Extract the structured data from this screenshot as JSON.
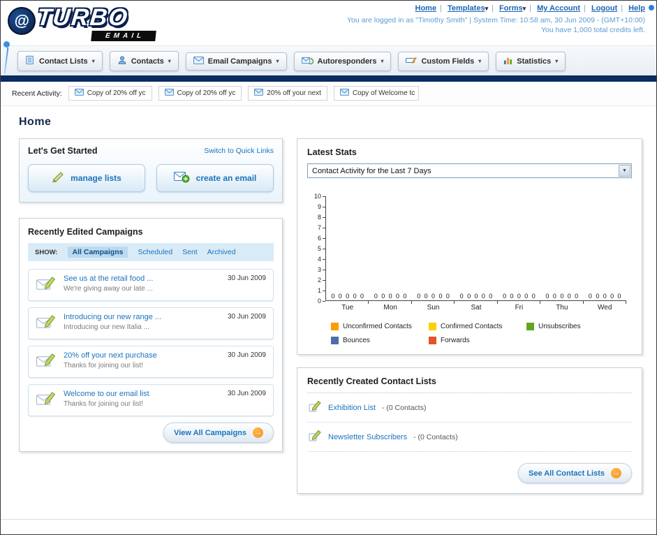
{
  "page_title": "Home",
  "colors": {
    "navy": "#0A2C60",
    "link_blue": "#1B74BD",
    "light_blue_text": "#5B9BD5",
    "accent_orange": "#F7941D"
  },
  "header": {
    "logo_primary": "TURBO",
    "logo_secondary": "EMAIL",
    "nav_links": [
      "Home",
      "Templates",
      "Forms",
      "My Account",
      "Logout",
      "Help"
    ],
    "login_info": "You are logged in as \"Timothy Smith\" | System Time: 10:58 am, 30 Jun 2009 - (GMT+10:00)",
    "credits_info": "You have 1,000 total credits left."
  },
  "tabs": [
    {
      "label": "Contact Lists"
    },
    {
      "label": "Contacts"
    },
    {
      "label": "Email Campaigns"
    },
    {
      "label": "Autoresponders"
    },
    {
      "label": "Custom Fields"
    },
    {
      "label": "Statistics"
    }
  ],
  "recent_activity": {
    "label": "Recent Activity:",
    "items": [
      "Copy of 20% off yc",
      "Copy of 20% off yc",
      "20% off your next",
      "Copy of Welcome tc"
    ]
  },
  "get_started": {
    "title": "Let's Get Started",
    "switch_link": "Switch to Quick Links",
    "manage_lists_label": "manage lists",
    "create_email_label": "create an email"
  },
  "campaigns": {
    "title": "Recently Edited Campaigns",
    "show_label": "SHOW:",
    "filters": [
      "All Campaigns",
      "Scheduled",
      "Sent",
      "Archived"
    ],
    "items": [
      {
        "title": "See us at the retail food ...",
        "subtitle": "We're giving away our late ...",
        "date": "30 Jun 2009"
      },
      {
        "title": "Introducing our new range ...",
        "subtitle": "Introducing our new Italia ...",
        "date": "30 Jun 2009"
      },
      {
        "title": "20% off your next purchase",
        "subtitle": "Thanks for joining our list!",
        "date": "30 Jun 2009"
      },
      {
        "title": "Welcome to our email list",
        "subtitle": "Thanks for joining our list!",
        "date": "30 Jun 2009"
      }
    ],
    "view_all_label": "View All Campaigns"
  },
  "stats": {
    "title": "Latest Stats",
    "dropdown_value": "Contact Activity for the Last 7 Days"
  },
  "contact_lists": {
    "title": "Recently Created Contact Lists",
    "items": [
      {
        "name": "Exhibition List",
        "detail": "- (0 Contacts)"
      },
      {
        "name": "Newsletter Subscribers",
        "detail": "- (0 Contacts)"
      }
    ],
    "see_all_label": "See All Contact Lists"
  },
  "chart_data": {
    "type": "bar",
    "title": "Contact Activity for the Last 7 Days",
    "categories": [
      "Tue",
      "Mon",
      "Sun",
      "Sat",
      "Fri",
      "Thu",
      "Wed"
    ],
    "series": [
      {
        "name": "Unconfirmed Contacts",
        "color": "#FF9C00",
        "values": [
          0,
          0,
          0,
          0,
          0,
          0,
          0
        ]
      },
      {
        "name": "Confirmed Contacts",
        "color": "#FFCE00",
        "values": [
          0,
          0,
          0,
          0,
          0,
          0,
          0
        ]
      },
      {
        "name": "Unsubscribes",
        "color": "#61A621",
        "values": [
          0,
          0,
          0,
          0,
          0,
          0,
          0
        ]
      },
      {
        "name": "Bounces",
        "color": "#4A6EA9",
        "values": [
          0,
          0,
          0,
          0,
          0,
          0,
          0
        ]
      },
      {
        "name": "Forwards",
        "color": "#E8502E",
        "values": [
          0,
          0,
          0,
          0,
          0,
          0,
          0
        ]
      }
    ],
    "ylim": [
      0,
      10
    ],
    "ytick_step": 1,
    "grid": false,
    "legend_position": "bottom",
    "xlabel": "",
    "ylabel": ""
  }
}
